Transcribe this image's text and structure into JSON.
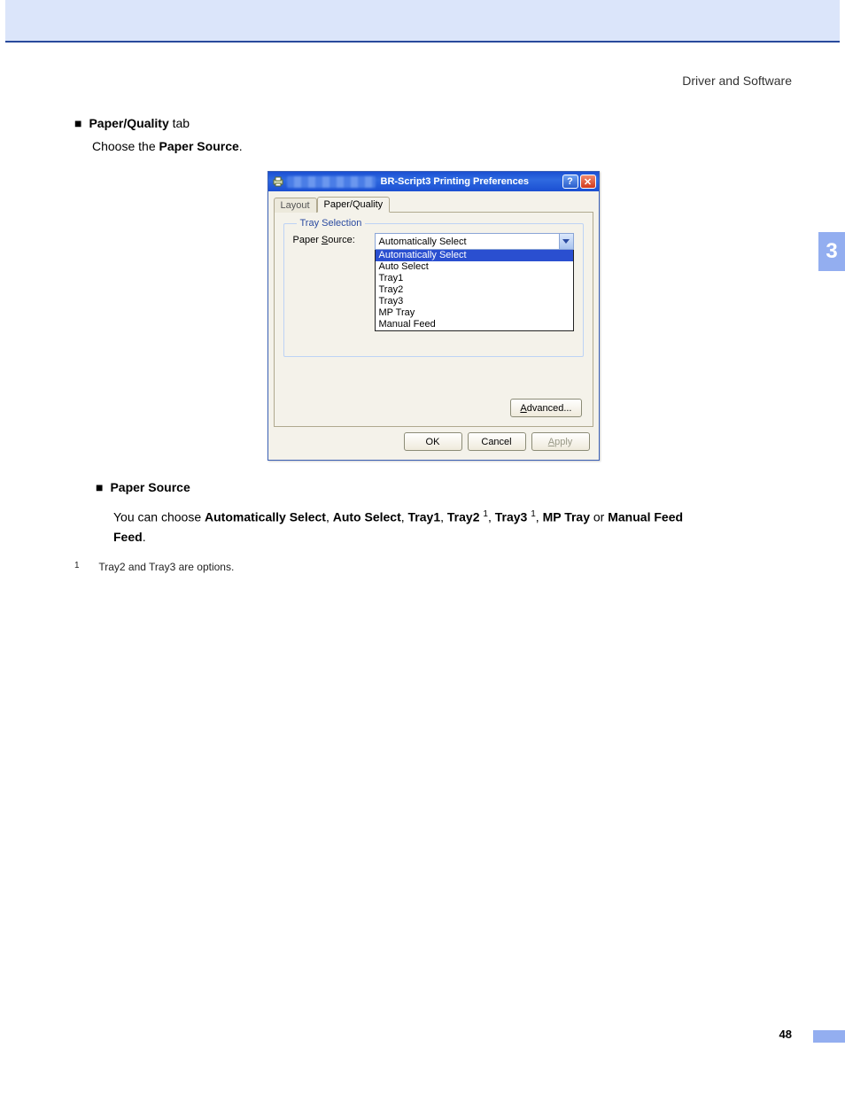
{
  "header": {
    "section": "Driver and Software"
  },
  "chapter": {
    "number": "3"
  },
  "page": {
    "number": "48"
  },
  "body": {
    "b1_bold": "Paper/Quality",
    "b1_rest": " tab",
    "choose_prefix": "Choose the ",
    "choose_bold": "Paper Source",
    "choose_suffix": ".",
    "b2_bold": "Paper Source",
    "desc_pre": "You can choose ",
    "opt1": "Automatically Select",
    "c1": ", ",
    "opt2": "Auto Select",
    "c2": ", ",
    "opt3": "Tray1",
    "c3": ", ",
    "opt4": "Tray2",
    "sup4": "1",
    "c4": ", ",
    "opt5": "Tray3",
    "sup5": "1",
    "c5": ", ",
    "opt6": "MP Tray",
    "or": " or ",
    "opt7": "Manual Feed",
    "desc_post": ".",
    "fn_num": "1",
    "fn_text": "Tray2 and Tray3 are options."
  },
  "dialog": {
    "title": "BR-Script3 Printing Preferences",
    "tabs": {
      "layout": "Layout",
      "paperq": "Paper/Quality"
    },
    "fieldset_legend": "Tray Selection",
    "source_label_pre": "Paper ",
    "source_label_ul": "S",
    "source_label_post": "ource:",
    "selected": "Automatically Select",
    "options": [
      "Automatically Select",
      "Auto Select",
      "Tray1",
      "Tray2",
      "Tray3",
      "MP Tray",
      "Manual Feed"
    ],
    "advanced_ul": "A",
    "advanced_rest": "dvanced...",
    "ok": "OK",
    "cancel": "Cancel",
    "apply_ul": "A",
    "apply_rest": "pply"
  }
}
